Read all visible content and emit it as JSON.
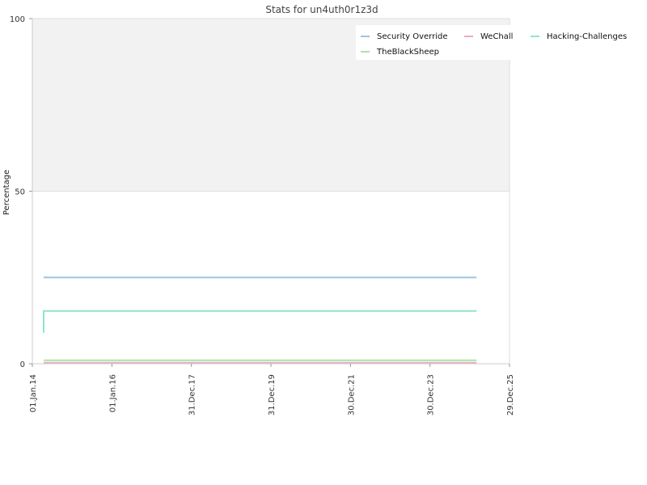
{
  "chart_data": {
    "type": "line",
    "title": "Stats for un4uth0r1z3d",
    "xlabel": "",
    "ylabel": "Percentage",
    "x_range": [
      "2014-01-01",
      "2025-12-29"
    ],
    "ylim": [
      0,
      100
    ],
    "y_ticks": [
      0,
      50,
      100
    ],
    "x_ticks": [
      {
        "date": "2014-01-01",
        "label": "01.Jan.14"
      },
      {
        "date": "2016-01-01",
        "label": "01.Jan.16"
      },
      {
        "date": "2017-12-31",
        "label": "31.Dec.17"
      },
      {
        "date": "2019-12-31",
        "label": "31.Dec.19"
      },
      {
        "date": "2021-12-30",
        "label": "30.Dec.21"
      },
      {
        "date": "2023-12-30",
        "label": "30.Dec.23"
      },
      {
        "date": "2025-12-29",
        "label": "29.Dec.25"
      }
    ],
    "bands": [
      {
        "from": 50,
        "to": 100,
        "color": "#f2f2f2"
      }
    ],
    "grid": true,
    "legend_position": "top-right",
    "series": [
      {
        "name": "Security Override",
        "color": "#9cc4e4",
        "points": [
          {
            "x": "2014-04-15",
            "y": 25.0
          },
          {
            "x": "2025-03-01",
            "y": 25.0
          }
        ]
      },
      {
        "name": "WeChall",
        "color": "#f0a8c8",
        "points": [
          {
            "x": "2014-04-15",
            "y": 0.3
          },
          {
            "x": "2025-03-01",
            "y": 0.3
          }
        ]
      },
      {
        "name": "Hacking-Challenges",
        "color": "#8ee6c8",
        "points": [
          {
            "x": "2014-04-15",
            "y": 9.0
          },
          {
            "x": "2014-04-15",
            "y": 15.3
          },
          {
            "x": "2025-03-01",
            "y": 15.3
          }
        ]
      },
      {
        "name": "TheBlackSheep",
        "color": "#a8e6a0",
        "points": [
          {
            "x": "2014-04-15",
            "y": 1.0
          },
          {
            "x": "2025-03-01",
            "y": 1.0
          }
        ]
      }
    ]
  }
}
